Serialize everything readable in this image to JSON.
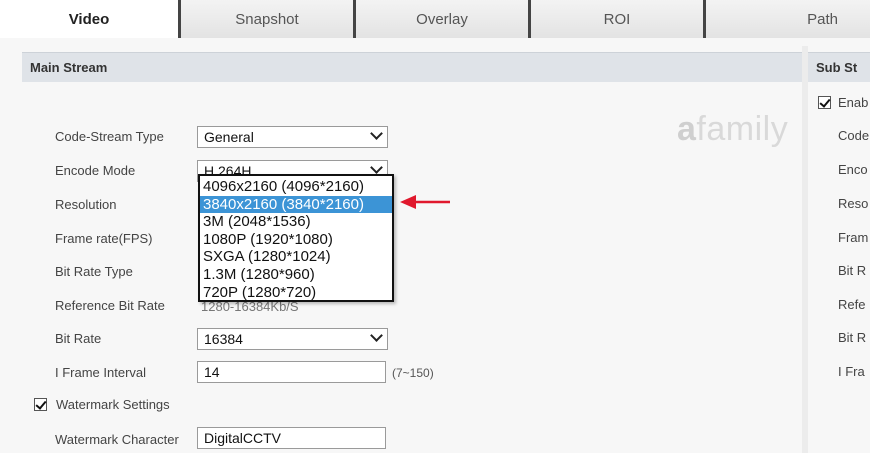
{
  "tabs": [
    {
      "label": "Video",
      "active": true
    },
    {
      "label": "Snapshot",
      "active": false
    },
    {
      "label": "Overlay",
      "active": false
    },
    {
      "label": "ROI",
      "active": false
    },
    {
      "label": "Path",
      "active": false
    }
  ],
  "main_stream": {
    "title": "Main Stream",
    "code_stream_type": {
      "label": "Code-Stream Type",
      "value": "General"
    },
    "encode_mode": {
      "label": "Encode Mode",
      "value": "H.264H"
    },
    "resolution": {
      "label": "Resolution"
    },
    "frame_rate": {
      "label": "Frame rate(FPS)"
    },
    "bit_rate_type": {
      "label": "Bit Rate Type"
    },
    "reference_bit_rate": {
      "label": "Reference Bit Rate",
      "value": "1280-16384Kb/S"
    },
    "bit_rate": {
      "label": "Bit Rate",
      "value": "16384"
    },
    "i_frame_interval": {
      "label": "I Frame Interval",
      "value": "14",
      "hint": "(7~150)"
    },
    "watermark_settings": {
      "label": "Watermark Settings",
      "checked": true
    },
    "watermark_character": {
      "label": "Watermark Character",
      "value": "DigitalCCTV"
    }
  },
  "resolution_options": [
    {
      "label": "4096x2160 (4096*2160)",
      "selected": false
    },
    {
      "label": "3840x2160 (3840*2160)",
      "selected": true
    },
    {
      "label": "3M (2048*1536)",
      "selected": false
    },
    {
      "label": "1080P (1920*1080)",
      "selected": false
    },
    {
      "label": "SXGA (1280*1024)",
      "selected": false
    },
    {
      "label": "1.3M (1280*960)",
      "selected": false
    },
    {
      "label": "720P (1280*720)",
      "selected": false
    }
  ],
  "sub_stream": {
    "title": "Sub St",
    "enable_label": "Enab",
    "enable_checked": true,
    "labels": [
      "Code",
      "Enco",
      "Reso",
      "Fram",
      "Bit R",
      "Refe",
      "Bit R",
      "I Fra"
    ]
  },
  "watermark_brand": {
    "prefix": "a",
    "rest": "family"
  },
  "colors": {
    "selected_option": "#3c94d6",
    "arrow": "#e0182d",
    "panel_header": "#dfe3e8"
  }
}
